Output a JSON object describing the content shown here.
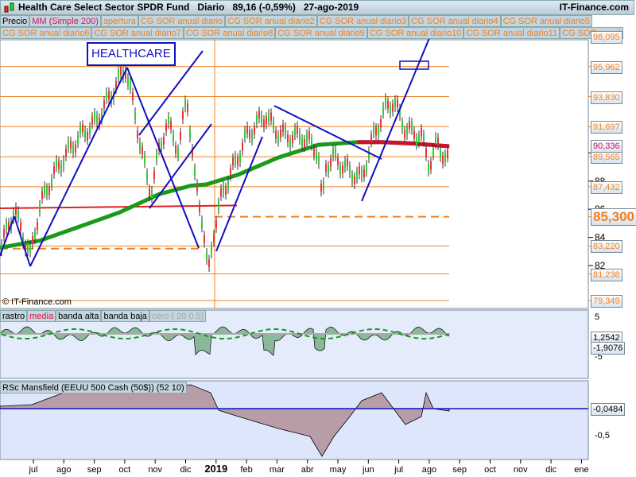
{
  "header": {
    "title": "Health Care Select Sector SPDR Fund",
    "period": "Diario",
    "price": "89,16 (-0,59%)",
    "date": "27-ago-2019",
    "site": "IT-Finance.com"
  },
  "legend": {
    "row1": [
      "Precio",
      "MM (Simple 200)",
      "apertura",
      "CG SOR anual diario",
      "CG SOR anual diario2",
      "CG SOR anual diario3",
      "CG SOR anual diario4",
      "CG SOR anual diario5"
    ],
    "row2": [
      "CG SOR anual diario6",
      "CG SOR anual diario7",
      "CG SOR anual diario8",
      "CG SOR anual diario9",
      "CG SOR anual diario10",
      "CG SOR anual diario11",
      "CG SOR anual"
    ]
  },
  "annotation": "HEALTHCARE",
  "copyright": "© IT-Finance.com",
  "panel1_legend": [
    "rastro",
    "media",
    "banda alta",
    "banda baja",
    "cero ( 20 0.5)"
  ],
  "panel2_legend": "RSc Mansfield (EEUU 500 Cash (50$)) (52 10)",
  "colors": {
    "level": "#f08020",
    "ma": "#1a9a1a",
    "ma_down": "#d01030",
    "trend": "#1010c0",
    "support": "#e02020"
  },
  "chart_data": {
    "type": "line",
    "title": "Health Care Select Sector SPDR Fund - Diario",
    "x_unit": "months since jul-2018",
    "x_ticks": [
      "jul",
      "ago",
      "sep",
      "oct",
      "nov",
      "dic",
      "2019",
      "feb",
      "mar",
      "abr",
      "may",
      "jun",
      "jul",
      "ago",
      "sep",
      "oct",
      "nov",
      "dic",
      "ene"
    ],
    "y_ticks": [
      "82",
      "84",
      "86",
      "88",
      "90"
    ],
    "ylim": [
      79.349,
      98.095
    ],
    "levels": [
      "98,095",
      "95,962",
      "93,830",
      "91,697",
      "89,565",
      "87,432",
      "85,300",
      "83,220",
      "81,238",
      "79,349"
    ],
    "level_values": [
      98.095,
      95.962,
      93.83,
      91.697,
      89.565,
      87.432,
      85.3,
      83.22,
      81.238,
      79.349
    ],
    "ma_label": "90,336",
    "ma_value": 90.336,
    "price": [
      [
        -1.05,
        83.2
      ],
      [
        -0.63,
        85.8
      ],
      [
        -0.1,
        82.5
      ],
      [
        0.21,
        86
      ],
      [
        0.6,
        88
      ],
      [
        1,
        89.5
      ],
      [
        1.52,
        91
      ],
      [
        2.04,
        92
      ],
      [
        2.56,
        94
      ],
      [
        3.03,
        95.9
      ],
      [
        3.21,
        94
      ],
      [
        3.47,
        91
      ],
      [
        3.73,
        88
      ],
      [
        3.86,
        87
      ],
      [
        4.13,
        90
      ],
      [
        4.39,
        92
      ],
      [
        4.78,
        90
      ],
      [
        5.04,
        94
      ],
      [
        5.3,
        88
      ],
      [
        5.56,
        85
      ],
      [
        5.74,
        81
      ],
      [
        5.9,
        84
      ],
      [
        6.21,
        87
      ],
      [
        6.61,
        89
      ],
      [
        7,
        91
      ],
      [
        7.39,
        92
      ],
      [
        7.65,
        92.5
      ],
      [
        7.91,
        91.5
      ],
      [
        8.3,
        91
      ],
      [
        8.83,
        91
      ],
      [
        9.35,
        90
      ],
      [
        9.48,
        86
      ],
      [
        9.61,
        89
      ],
      [
        9.87,
        89.5
      ],
      [
        10.39,
        88.5
      ],
      [
        10.78,
        88
      ],
      [
        11.17,
        91
      ],
      [
        11.57,
        93
      ],
      [
        11.83,
        93.5
      ],
      [
        12.22,
        91.5
      ],
      [
        12.74,
        91
      ],
      [
        13,
        89
      ],
      [
        13.26,
        90.5
      ],
      [
        13.53,
        89.5
      ],
      [
        13.66,
        89.16
      ]
    ],
    "ma200": [
      [
        -1.1,
        83.1
      ],
      [
        0.21,
        83.6
      ],
      [
        1.52,
        84.6
      ],
      [
        2.82,
        85.6
      ],
      [
        4.13,
        86.9
      ],
      [
        5.17,
        87.5
      ],
      [
        5.69,
        87.6
      ],
      [
        6.74,
        88.3
      ],
      [
        8.04,
        89.5
      ],
      [
        9.35,
        90.4
      ],
      [
        10.65,
        90.6
      ],
      [
        11.44,
        90.6
      ],
      [
        12.48,
        90.5
      ],
      [
        13.66,
        90.3
      ]
    ],
    "panel1": {
      "yticks": [
        "5",
        "0",
        "-5"
      ],
      "labels": [
        "1,2542",
        "-1,9076"
      ]
    },
    "panel2": {
      "yticks": [
        "-0,5"
      ],
      "label": "-0,0484"
    }
  }
}
